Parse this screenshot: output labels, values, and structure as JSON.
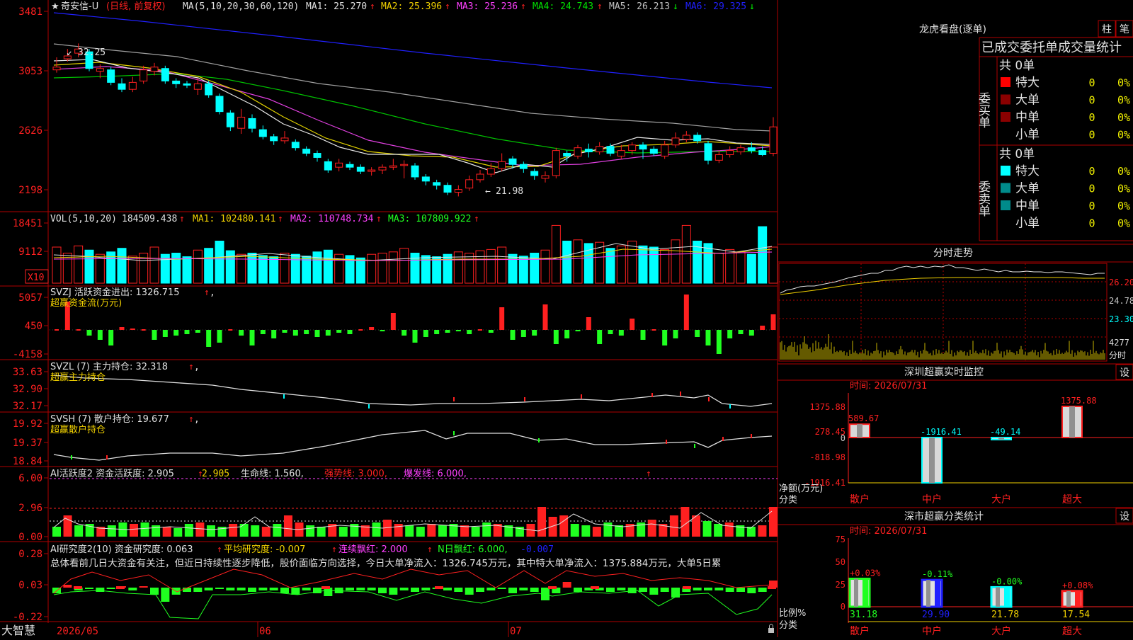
{
  "colors": {
    "up": "#ff2020",
    "down": "#00ffff",
    "grid": "#b00000",
    "white": "#e0e0e0",
    "yellow": "#f0d000",
    "magenta": "#ff40ff",
    "green": "#00e000",
    "blue": "#2020ff",
    "gray": "#a0a0a0",
    "bar_green": "#20ff20"
  },
  "main": {
    "title_star": "★",
    "stock_name": "奇安信-U",
    "period": "(日线, 前复权)",
    "ma_param": "MA(5,10,20,30,60,120)",
    "ma_items": [
      {
        "label": "MA1: 25.270",
        "color": "#e0e0e0"
      },
      {
        "label": "MA2: 25.396",
        "color": "#f0d000"
      },
      {
        "label": "MA3: 25.236",
        "color": "#ff40ff"
      },
      {
        "label": "MA4: 24.743",
        "color": "#00e000"
      },
      {
        "label": "MA5: 26.213",
        "color": "#c0c0c0"
      },
      {
        "label": "MA6: 29.325",
        "color": "#2020ff"
      }
    ],
    "ma_arrows": [
      "↑",
      "↑",
      "↑",
      "↑",
      "↓",
      "↓"
    ],
    "y_ticks": [
      "3481",
      "3053",
      "2626",
      "2198"
    ],
    "high_label": "32.25",
    "low_label": "21.98"
  },
  "vol": {
    "header": "VOL(5,10,20)",
    "value": "184509.438",
    "items": [
      "MA1: 102480.141",
      "MA2: 110748.734",
      "MA3: 107809.922"
    ],
    "y_ticks": [
      "18451",
      "9112"
    ],
    "unit": "X10"
  },
  "svzj": {
    "header": "SVZJ  活跃资金进出: 1326.715",
    "subtitle": "超赢资金流(万元)",
    "y_ticks": [
      "5057",
      "450",
      "-4158"
    ]
  },
  "svzl": {
    "header": "SVZL (7) 主力持仓: 32.318",
    "subtitle": "超赢主力持仓",
    "y_ticks": [
      "33.63",
      "32.90",
      "32.17"
    ]
  },
  "svsh": {
    "header": "SVSH (7) 散户持仓: 19.677",
    "subtitle": "超赢散户持仓",
    "y_ticks": [
      "19.92",
      "19.37",
      "18.84"
    ]
  },
  "ai_active": {
    "header": "AI活跃度2 资金活跃度: 2.905",
    "v2": "2.905",
    "life": "生命线: 1.560,",
    "strong": "强势线: 3.000,",
    "burst": "爆发线: 6.000,",
    "y_ticks": [
      "6.00",
      "2.96",
      "0.00"
    ]
  },
  "ai_research": {
    "header": "AI研究度2(10) 资金研究度: 0.063",
    "avg": "平均研究度: -0.007",
    "cont": "连续飘红: 2.000",
    "ndays": "N日飘红: 6.000,",
    "last": "-0.007",
    "summary": "总体看前几日大资金有关注，但近日持续性逐步降低，股价面临方向选择，今日大单净流入：1326.745万元，其中特大单净流入：1375.884万元，大单5日累",
    "y_ticks": [
      "0.28",
      "0.03",
      "-0.22"
    ]
  },
  "bottom": {
    "logo": "大智慧",
    "dates": [
      "2026/05",
      "06",
      "07"
    ]
  },
  "dragon": {
    "title": "龙虎看盘(逐单)",
    "btn1": "柱",
    "btn2": "笔",
    "subtitle": "已成交委托单成交量统计",
    "buy_label": "委买单",
    "sell_label": "委卖单",
    "buy_total": "共 0单",
    "sell_total": "共 0单",
    "rows": [
      {
        "name": "特大",
        "val": "0",
        "pct": "0%"
      },
      {
        "name": "大单",
        "val": "0",
        "pct": "0%"
      },
      {
        "name": "中单",
        "val": "0",
        "pct": "0%"
      },
      {
        "name": "小单",
        "val": "0",
        "pct": "0%"
      }
    ],
    "buy_colors": [
      "#ff0000",
      "#8b0000",
      "#8b0000",
      "#000000"
    ],
    "sell_colors": [
      "#00ffff",
      "#008b8b",
      "#008b8b",
      "#000000"
    ]
  },
  "fenshi": {
    "title": "分时走势",
    "y_ticks": [
      "26.20",
      "24.78",
      "23.30"
    ],
    "vol_tick": "4277",
    "label": "分时"
  },
  "monitor": {
    "title": "深圳超赢实时监控",
    "btn": "设",
    "time": "时间: 2026/07/31",
    "y_ticks": [
      "1375.88",
      "278.45",
      "0",
      "-818.98",
      "-1916.41"
    ],
    "bar_values": [
      {
        "name": "散户",
        "value": 589.67,
        "label": "589.67"
      },
      {
        "name": "中户",
        "value": -1916.41,
        "label": "-1916.41"
      },
      {
        "name": "大户",
        "value": -49.14,
        "label": "-49.14"
      },
      {
        "name": "超大",
        "value": 1375.88,
        "label": "1375.88"
      }
    ],
    "unit": "净额(万元)",
    "cat": "分类"
  },
  "classify": {
    "title": "深市超赢分类统计",
    "btn": "设",
    "time": "时间: 2026/07/31",
    "y_ticks": [
      "75",
      "50",
      "25",
      "0"
    ],
    "bars": [
      {
        "name": "散户",
        "value": 31.18,
        "label": "31.18",
        "change": "+0.03%",
        "color": "#20ff20"
      },
      {
        "name": "中户",
        "value": 29.9,
        "label": "29.90",
        "change": "-0.11%",
        "color": "#2020ff"
      },
      {
        "name": "大户",
        "value": 21.78,
        "label": "21.78",
        "change": "-0.00%",
        "color": "#00ffff"
      },
      {
        "name": "超大",
        "value": 17.54,
        "label": "17.54",
        "change": "+0.08%",
        "color": "#ff2020"
      }
    ],
    "unit": "比例%",
    "cat": "分类"
  },
  "chart_data": {
    "type": "candlestick",
    "ylim": [
      2198,
      3481
    ],
    "candles": [
      {
        "o": 3060,
        "c": 3080,
        "h": 3150,
        "l": 3040
      },
      {
        "o": 3140,
        "c": 3160,
        "h": 3210,
        "l": 3120
      },
      {
        "o": 3180,
        "c": 3210,
        "h": 3250,
        "l": 3150
      },
      {
        "o": 3190,
        "c": 3070,
        "h": 3210,
        "l": 3050
      },
      {
        "o": 3050,
        "c": 3070,
        "h": 3100,
        "l": 3000
      },
      {
        "o": 3060,
        "c": 2970,
        "h": 3080,
        "l": 2950
      },
      {
        "o": 2960,
        "c": 2920,
        "h": 3000,
        "l": 2900
      },
      {
        "o": 2920,
        "c": 2970,
        "h": 3010,
        "l": 2900
      },
      {
        "o": 2980,
        "c": 3060,
        "h": 3090,
        "l": 2960
      },
      {
        "o": 3050,
        "c": 3080,
        "h": 3110,
        "l": 3020
      },
      {
        "o": 3070,
        "c": 2980,
        "h": 3090,
        "l": 2960
      },
      {
        "o": 2980,
        "c": 2960,
        "h": 3000,
        "l": 2930
      },
      {
        "o": 2960,
        "c": 2950,
        "h": 2980,
        "l": 2930
      },
      {
        "o": 2920,
        "c": 2960,
        "h": 3000,
        "l": 2880
      },
      {
        "o": 2960,
        "c": 2880,
        "h": 2980,
        "l": 2860
      },
      {
        "o": 2870,
        "c": 2760,
        "h": 2890,
        "l": 2740
      },
      {
        "o": 2750,
        "c": 2650,
        "h": 2770,
        "l": 2620
      },
      {
        "o": 2640,
        "c": 2720,
        "h": 2780,
        "l": 2600
      },
      {
        "o": 2710,
        "c": 2640,
        "h": 2740,
        "l": 2610
      },
      {
        "o": 2630,
        "c": 2580,
        "h": 2660,
        "l": 2560
      },
      {
        "o": 2580,
        "c": 2550,
        "h": 2600,
        "l": 2520
      },
      {
        "o": 2550,
        "c": 2570,
        "h": 2620,
        "l": 2530
      },
      {
        "o": 2540,
        "c": 2500,
        "h": 2560,
        "l": 2480
      },
      {
        "o": 2490,
        "c": 2460,
        "h": 2510,
        "l": 2440
      },
      {
        "o": 2460,
        "c": 2430,
        "h": 2480,
        "l": 2400
      },
      {
        "o": 2400,
        "c": 2340,
        "h": 2420,
        "l": 2320
      },
      {
        "o": 2360,
        "c": 2390,
        "h": 2420,
        "l": 2330
      },
      {
        "o": 2380,
        "c": 2360,
        "h": 2400,
        "l": 2340
      },
      {
        "o": 2360,
        "c": 2330,
        "h": 2380,
        "l": 2310
      },
      {
        "o": 2330,
        "c": 2340,
        "h": 2360,
        "l": 2300
      },
      {
        "o": 2340,
        "c": 2360,
        "h": 2380,
        "l": 2310
      },
      {
        "o": 2360,
        "c": 2370,
        "h": 2420,
        "l": 2340
      },
      {
        "o": 2380,
        "c": 2380,
        "h": 2410,
        "l": 2280
      },
      {
        "o": 2370,
        "c": 2290,
        "h": 2390,
        "l": 2270
      },
      {
        "o": 2290,
        "c": 2260,
        "h": 2310,
        "l": 2230
      },
      {
        "o": 2250,
        "c": 2230,
        "h": 2270,
        "l": 2200
      },
      {
        "o": 2230,
        "c": 2180,
        "h": 2250,
        "l": 2160
      },
      {
        "o": 2180,
        "c": 2200,
        "h": 2230,
        "l": 2150
      },
      {
        "o": 2210,
        "c": 2270,
        "h": 2300,
        "l": 2190
      },
      {
        "o": 2270,
        "c": 2310,
        "h": 2340,
        "l": 2250
      },
      {
        "o": 2310,
        "c": 2350,
        "h": 2390,
        "l": 2290
      },
      {
        "o": 2350,
        "c": 2400,
        "h": 2460,
        "l": 2330
      },
      {
        "o": 2420,
        "c": 2380,
        "h": 2440,
        "l": 2350
      },
      {
        "o": 2380,
        "c": 2350,
        "h": 2400,
        "l": 2320
      },
      {
        "o": 2330,
        "c": 2300,
        "h": 2350,
        "l": 2270
      },
      {
        "o": 2280,
        "c": 2300,
        "h": 2330,
        "l": 2250
      },
      {
        "o": 2300,
        "c": 2480,
        "h": 2500,
        "l": 2280
      },
      {
        "o": 2460,
        "c": 2440,
        "h": 2480,
        "l": 2400
      },
      {
        "o": 2440,
        "c": 2500,
        "h": 2520,
        "l": 2420
      },
      {
        "o": 2490,
        "c": 2470,
        "h": 2530,
        "l": 2430
      },
      {
        "o": 2470,
        "c": 2510,
        "h": 2540,
        "l": 2450
      },
      {
        "o": 2510,
        "c": 2460,
        "h": 2530,
        "l": 2440
      },
      {
        "o": 2440,
        "c": 2480,
        "h": 2520,
        "l": 2420
      },
      {
        "o": 2480,
        "c": 2520,
        "h": 2540,
        "l": 2450
      },
      {
        "o": 2520,
        "c": 2490,
        "h": 2540,
        "l": 2420
      },
      {
        "o": 2490,
        "c": 2460,
        "h": 2510,
        "l": 2440
      },
      {
        "o": 2440,
        "c": 2520,
        "h": 2550,
        "l": 2420
      },
      {
        "o": 2520,
        "c": 2570,
        "h": 2610,
        "l": 2500
      },
      {
        "o": 2560,
        "c": 2590,
        "h": 2620,
        "l": 2540
      },
      {
        "o": 2590,
        "c": 2550,
        "h": 2610,
        "l": 2530
      },
      {
        "o": 2530,
        "c": 2410,
        "h": 2550,
        "l": 2380
      },
      {
        "o": 2410,
        "c": 2450,
        "h": 2480,
        "l": 2390
      },
      {
        "o": 2450,
        "c": 2480,
        "h": 2510,
        "l": 2430
      },
      {
        "o": 2470,
        "c": 2500,
        "h": 2520,
        "l": 2450
      },
      {
        "o": 2500,
        "c": 2480,
        "h": 2540,
        "l": 2460
      },
      {
        "o": 2480,
        "c": 2450,
        "h": 2510,
        "l": 2440
      },
      {
        "o": 2460,
        "c": 2650,
        "h": 2720,
        "l": 2440
      }
    ]
  }
}
